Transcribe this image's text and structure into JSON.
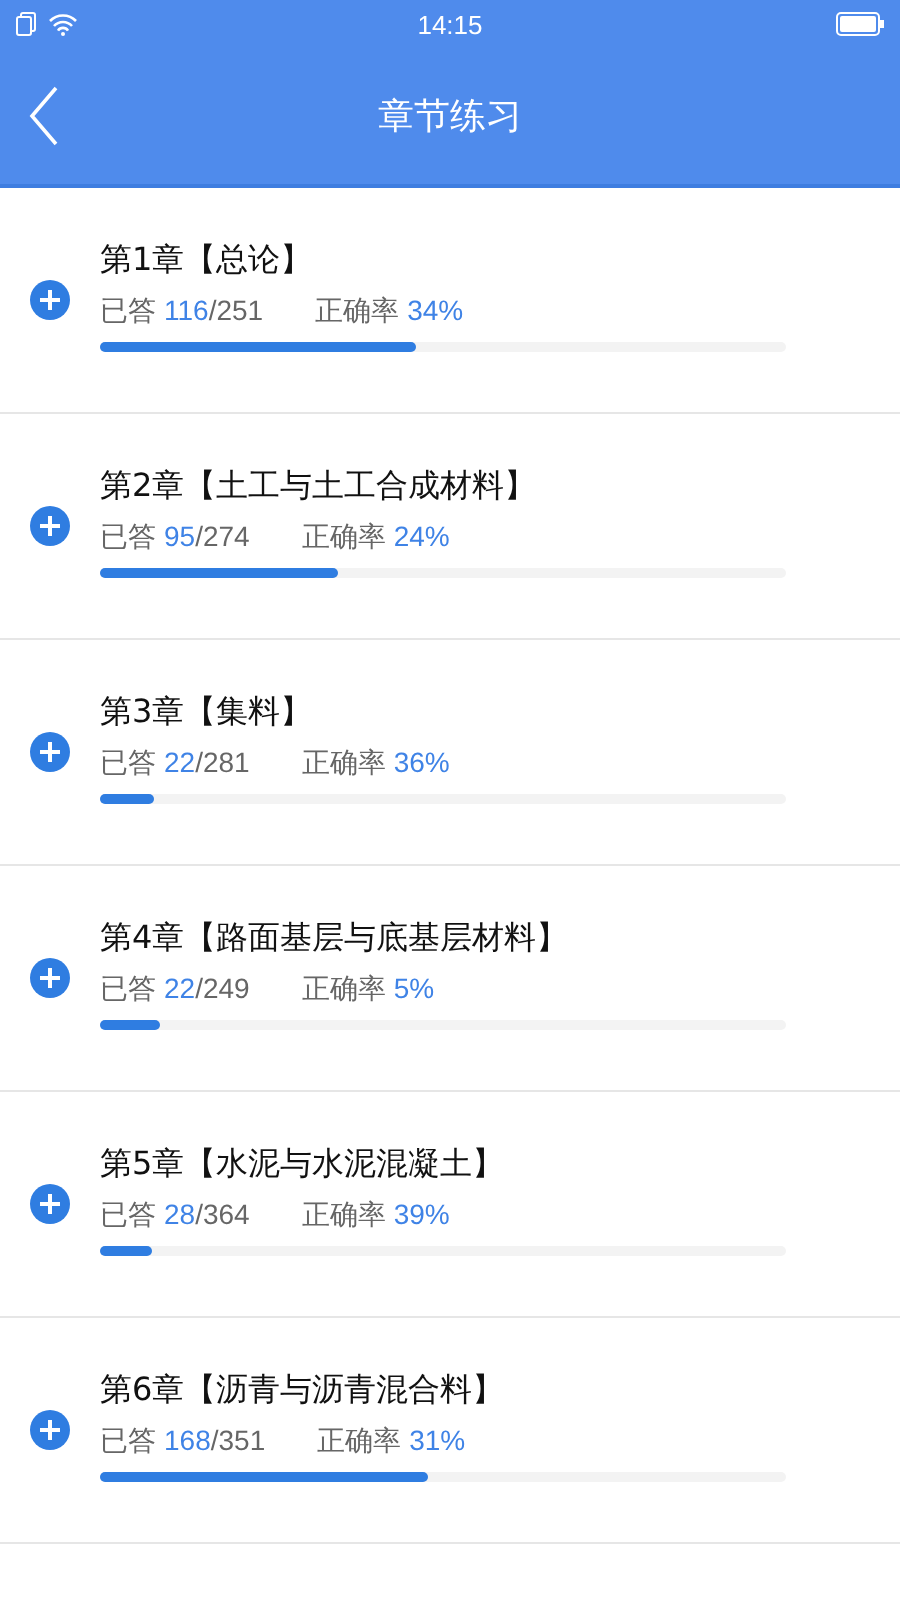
{
  "status_bar": {
    "time": "14:15"
  },
  "header": {
    "title": "章节练习"
  },
  "chapters": [
    {
      "title": "第1章【总论】",
      "answered_label": "已答",
      "answered": "116",
      "total": "/251",
      "accuracy_label": "正确率",
      "accuracy": "34%",
      "level": 0.462
    },
    {
      "title": "第2章【土工与土工合成材料】",
      "answered_label": "已答",
      "answered": "95",
      "total": "/274",
      "accuracy_label": "正确率",
      "accuracy": "24%",
      "level": 0.347
    },
    {
      "title": "第3章【集料】",
      "answered_label": "已答",
      "answered": "22",
      "total": "/281",
      "accuracy_label": "正确率",
      "accuracy": "36%",
      "level": 0.078
    },
    {
      "title": "第4章【路面基层与底基层材料】",
      "answered_label": "已答",
      "answered": "22",
      "total": "/249",
      "accuracy_label": "正确率",
      "accuracy": "5%",
      "level": 0.088
    },
    {
      "title": "第5章【水泥与水泥混凝土】",
      "answered_label": "已答",
      "answered": "28",
      "total": "/364",
      "accuracy_label": "正确率",
      "accuracy": "39%",
      "level": 0.077
    },
    {
      "title": "第6章【沥青与沥青混合料】",
      "answered_label": "已答",
      "answered": "168",
      "total": "/351",
      "accuracy_label": "正确率",
      "accuracy": "31%",
      "level": 0.479
    }
  ]
}
